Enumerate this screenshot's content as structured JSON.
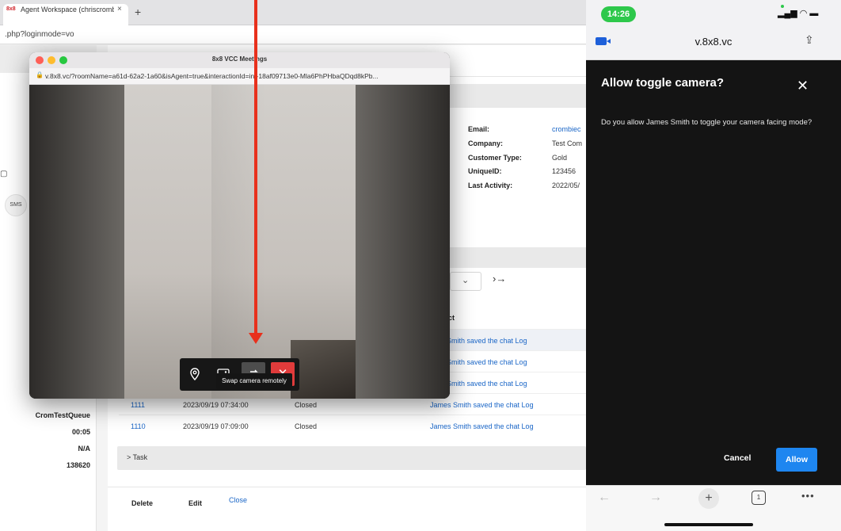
{
  "browser": {
    "tab_logo": "8x8",
    "tab_title": "Agent Workspace (chriscromb",
    "tab_close": "×",
    "new_tab": "+",
    "url": ".php?loginmode=vo"
  },
  "workspace": {
    "sms_label": "SMS",
    "info": {
      "labels": [
        "Email:",
        "Company:",
        "Customer Type:",
        "UniqueID:",
        "Last Activity:"
      ],
      "values": [
        "crombiec",
        "Test Com",
        "Gold",
        "123456",
        "2022/05/"
      ]
    },
    "pager_next": "›→",
    "column_header": "ct",
    "rows": [
      {
        "id": "",
        "date": "",
        "status": "",
        "message": "es Smith saved the chat Log"
      },
      {
        "id": "",
        "date": "",
        "status": "",
        "message": "es Smith saved the chat Log"
      },
      {
        "id": "",
        "date": "",
        "status": "",
        "message": "es Smith saved the chat Log"
      },
      {
        "id": "1111",
        "date": "2023/09/19 07:34:00",
        "status": "Closed",
        "message": "James Smith saved the chat Log"
      },
      {
        "id": "1110",
        "date": "2023/09/19 07:09:00",
        "status": "Closed",
        "message": "James Smith saved the chat Log"
      }
    ],
    "queue_info": [
      "CromTestQueue",
      "00:05",
      "N/A",
      "138620"
    ],
    "task_label": "> Task",
    "footer": {
      "delete": "Delete",
      "edit": "Edit",
      "close": "Close"
    }
  },
  "video_window": {
    "title": "8x8 VCC Meetings",
    "url": "v.8x8.vc/?roomName=a61d-62a2-1a60&isAgent=true&interactionId=int-18af09713e0-Mla6PhPHbaQDqd8kPb...",
    "tooltip": "Swap camera remotely",
    "toolbar": {
      "location_icon": "location-pin-icon",
      "image_icon": "image-icon",
      "swap_icon": "camera-swap-icon",
      "end_icon": "close-icon"
    }
  },
  "phone": {
    "time": "14:26",
    "domain": "v.8x8.vc",
    "dialog_title": "Allow toggle camera?",
    "dialog_body": "Do you allow James Smith to toggle your camera facing mode?",
    "cancel": "Cancel",
    "allow": "Allow",
    "tab_count": "1"
  },
  "colors": {
    "accent_blue": "#1a66c7",
    "allow_blue": "#1e86f0",
    "end_red": "#e03b3b",
    "arrow_red": "#e8301c",
    "time_green": "#2ec84b"
  }
}
